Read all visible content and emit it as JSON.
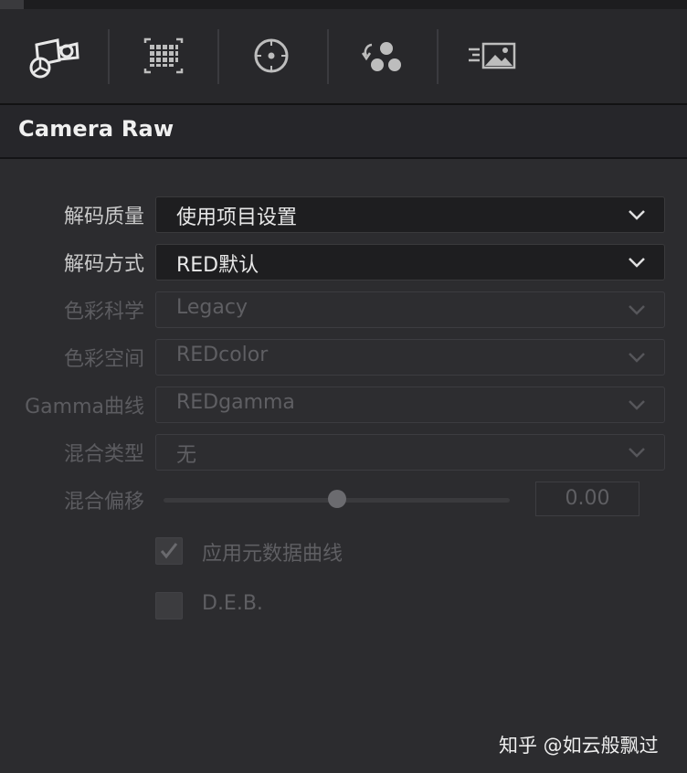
{
  "toolbar": {
    "tools": [
      {
        "icon": "camera-raw-icon"
      },
      {
        "icon": "color-chart-icon"
      },
      {
        "icon": "target-icon"
      },
      {
        "icon": "color-match-icon"
      },
      {
        "icon": "image-wipe-icon"
      }
    ]
  },
  "panel": {
    "title": "Camera Raw",
    "rows": {
      "decode_quality": {
        "label": "解码质量",
        "value": "使用项目设置"
      },
      "decode_using": {
        "label": "解码方式",
        "value": "RED默认"
      },
      "color_science": {
        "label": "色彩科学",
        "value": "Legacy"
      },
      "color_space": {
        "label": "色彩空间",
        "value": "REDcolor"
      },
      "gamma_curve": {
        "label": "Gamma曲线",
        "value": "REDgamma"
      },
      "blend_type": {
        "label": "混合类型",
        "value": "无"
      },
      "blend_offset": {
        "label": "混合偏移",
        "value": "0.00",
        "slider_level": 0.5
      }
    },
    "checkboxes": {
      "apply_metadata_curves": {
        "label": "应用元数据曲线",
        "checked": true
      },
      "deb": {
        "label": "D.E.B.",
        "checked": false
      }
    }
  },
  "watermark": "知乎 @如云般飘过"
}
